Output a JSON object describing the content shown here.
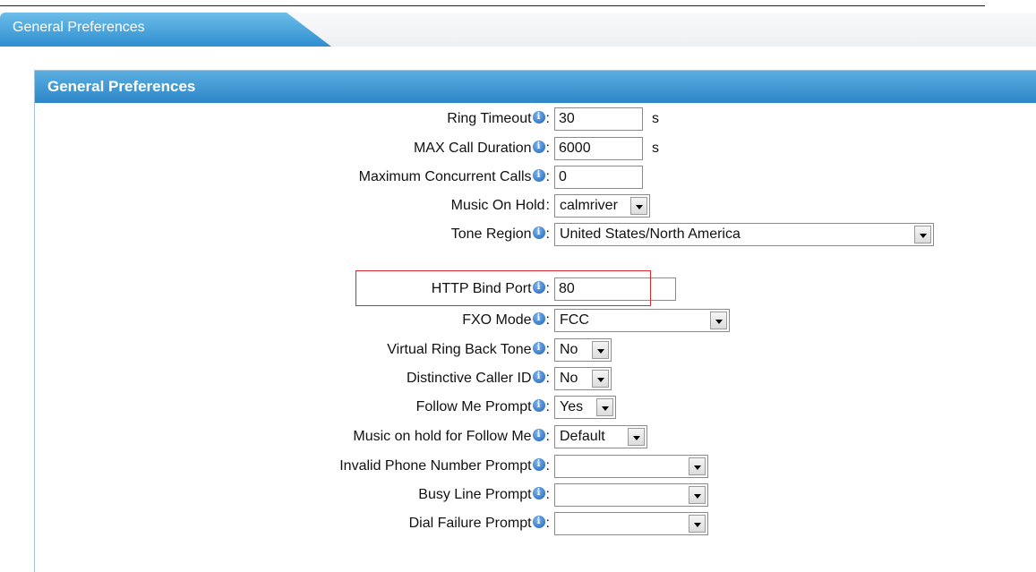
{
  "tab": {
    "label": "General Preferences"
  },
  "panel": {
    "title": "General Preferences"
  },
  "fields": {
    "ring_timeout": {
      "label": "Ring Timeout",
      "value": "30",
      "unit": "s"
    },
    "max_call_duration": {
      "label": "MAX Call Duration",
      "value": "6000",
      "unit": "s"
    },
    "max_concurrent_calls": {
      "label": "Maximum Concurrent Calls",
      "value": "0"
    },
    "music_on_hold": {
      "label": "Music On Hold",
      "value": "calmriver"
    },
    "tone_region": {
      "label": "Tone Region",
      "value": "United States/North America"
    },
    "http_bind_port": {
      "label": "HTTP Bind Port",
      "value": "80"
    },
    "fxo_mode": {
      "label": "FXO Mode",
      "value": "FCC"
    },
    "virtual_ring_back_tone": {
      "label": "Virtual Ring Back Tone",
      "value": "No"
    },
    "distinctive_caller_id": {
      "label": "Distinctive Caller ID",
      "value": "No"
    },
    "follow_me_prompt": {
      "label": "Follow Me Prompt",
      "value": "Yes"
    },
    "moh_follow_me": {
      "label": "Music on hold for Follow Me",
      "value": "Default"
    },
    "invalid_phone_prompt": {
      "label": "Invalid Phone Number Prompt",
      "value": ""
    },
    "busy_line_prompt": {
      "label": "Busy Line Prompt",
      "value": ""
    },
    "dial_failure_prompt": {
      "label": "Dial Failure Prompt",
      "value": ""
    }
  },
  "colors": {
    "header_blue": "#2e86c8",
    "highlight_red": "#e0262c"
  },
  "icons": {
    "info": "info-icon",
    "dropdown": "chevron-down-icon"
  }
}
